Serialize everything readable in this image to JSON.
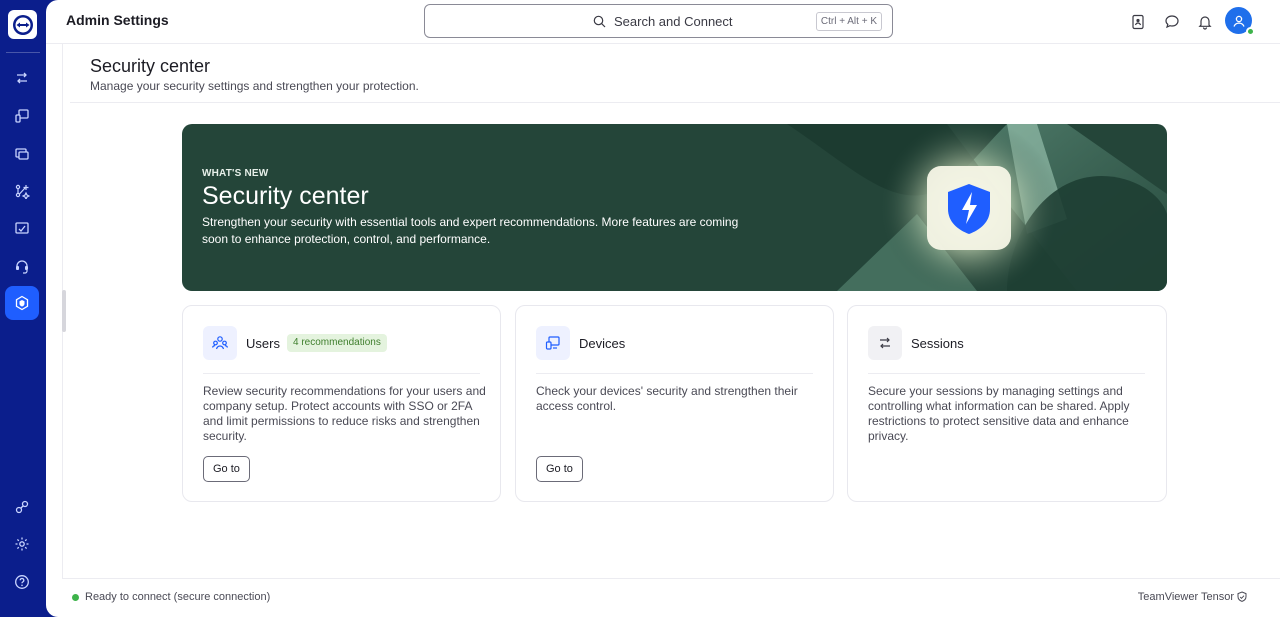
{
  "app": {
    "title": "Admin Settings"
  },
  "search": {
    "label": "Search and Connect",
    "shortcut": "Ctrl + Alt + K"
  },
  "rail": {
    "items": [
      {
        "name": "remote-connect-icon",
        "active": false
      },
      {
        "name": "devices-icon",
        "active": false
      },
      {
        "name": "sessions-icon",
        "active": false
      },
      {
        "name": "integrations-icon",
        "active": false
      },
      {
        "name": "management-icon",
        "active": false
      },
      {
        "name": "support-icon",
        "active": false
      },
      {
        "name": "security-center-icon",
        "active": true
      }
    ],
    "bottom": [
      {
        "name": "connections-icon"
      },
      {
        "name": "settings-icon"
      },
      {
        "name": "help-icon"
      }
    ]
  },
  "page": {
    "title": "Security center",
    "subtitle": "Manage your security settings and strengthen your protection."
  },
  "hero": {
    "kicker": "WHAT'S NEW",
    "title": "Security center",
    "description": "Strengthen your security with essential tools and expert recommendations. More features are coming soon to enhance protection, control, and performance."
  },
  "cards": [
    {
      "title": "Users",
      "badge": "4 recommendations",
      "description": "Review security recommendations for your users and company setup. Protect accounts with SSO or 2FA and limit permissions to reduce risks and strengthen security.",
      "button": "Go to"
    },
    {
      "title": "Devices",
      "description": "Check your devices' security and strengthen their access control.",
      "button": "Go to"
    },
    {
      "title": "Sessions",
      "description": "Secure your sessions by managing settings and controlling what information can be shared. Apply restrictions to protect sensitive data and enhance privacy."
    }
  ],
  "status": {
    "text": "Ready to connect (secure connection)",
    "product": "TeamViewer Tensor"
  },
  "colors": {
    "rail": "#0b1e8c",
    "accent": "#1f5eff",
    "hero": "#244539",
    "status_ok": "#3db34a"
  }
}
